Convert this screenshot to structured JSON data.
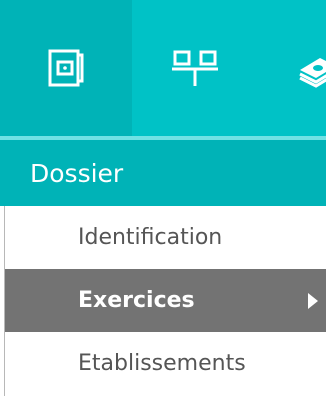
{
  "icon_tabs": [
    {
      "icon": "folder-book-icon",
      "active": true
    },
    {
      "icon": "org-chart-icon",
      "active": false
    },
    {
      "icon": "money-stack-icon",
      "active": false
    }
  ],
  "section": {
    "title": "Dossier"
  },
  "menu": {
    "items": [
      {
        "label": "Identification",
        "selected": false
      },
      {
        "label": "Exercices",
        "selected": true
      },
      {
        "label": "Etablissements",
        "selected": false
      }
    ]
  },
  "colors": {
    "iconbar": "#00c2c6",
    "active_tab": "#00b3b7",
    "header": "#00b3b7",
    "selected_item": "#737373",
    "item_text": "#555555"
  }
}
